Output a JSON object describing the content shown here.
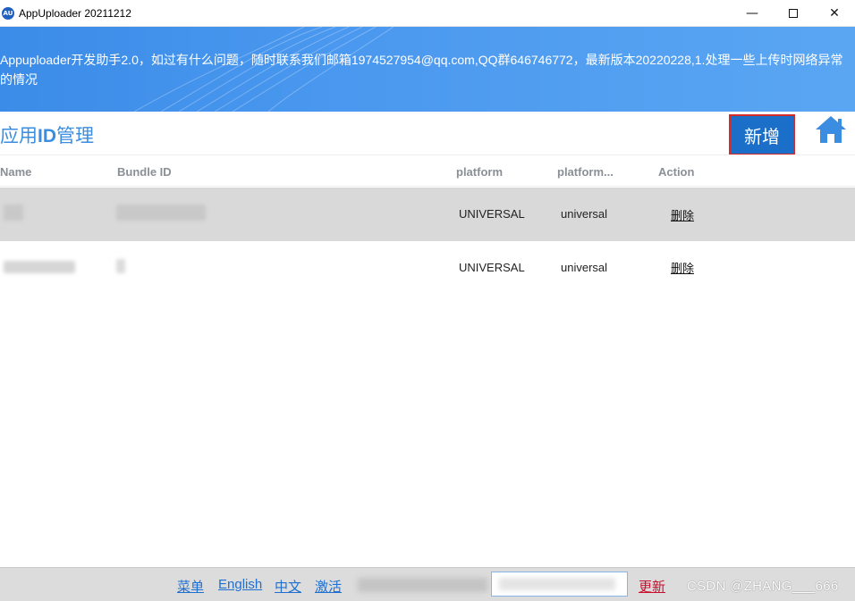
{
  "window": {
    "title": "AppUploader 20211212",
    "icon_text": "AU",
    "controls": {
      "minimize": "—",
      "close": "✕"
    }
  },
  "banner": {
    "text": "Appuploader开发助手2.0，如过有什么问题，随时联系我们邮箱1974527954@qq.com,QQ群646746772，最新版本20220228,1.处理一些上传时网络异常的情况"
  },
  "header": {
    "title_prefix": "应用",
    "title_bold": "ID",
    "title_suffix": "管理",
    "add_button": "新增",
    "home_icon": "home-icon"
  },
  "table": {
    "columns": [
      "Name",
      "Bundle ID",
      "platform",
      "platform...",
      "Action"
    ],
    "rows": [
      {
        "platform": "UNIVERSAL",
        "platform2": "universal",
        "action": "删除",
        "selected": true
      },
      {
        "platform": "UNIVERSAL",
        "platform2": "universal",
        "action": "删除",
        "selected": false
      }
    ]
  },
  "footer": {
    "links": [
      "菜单",
      "English",
      "中文",
      "激活"
    ],
    "update": "更新",
    "watermark": "CSDN @ZHANG___666"
  },
  "colors": {
    "banner": "#4a98ef",
    "accent": "#3a8de0",
    "add_button_bg": "#1c6fc8",
    "add_button_border": "#d42a2a",
    "selected_row": "#d9d9d9",
    "footer_bg": "#dcdcdc"
  }
}
